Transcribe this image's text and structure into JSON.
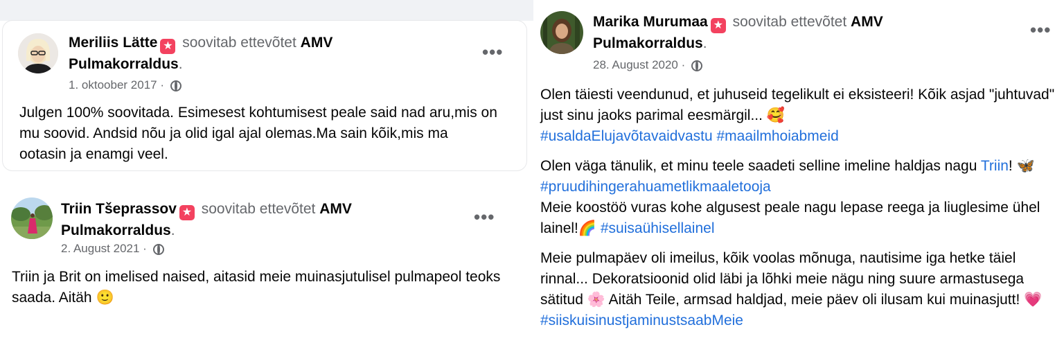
{
  "posts": [
    {
      "author": "Meriliis Lätte",
      "action": "soovitab ettevõtet",
      "page_line1": "AMV",
      "page_line2": "Pulmakorraldus",
      "date": "1. oktoober 2017",
      "text": "Julgen 100% soovitada. Esimesest kohtumisest peale said nad aru,mis on mu soovid. Andsid nõu ja olid igal ajal olemas.Ma sain kõik,mis ma ootasin ja enamgi veel."
    },
    {
      "author": "Triin Tšeprassov",
      "action": "soovitab ettevõtet",
      "page_line1": "AMV",
      "page_line2": "Pulmakorraldus",
      "date": "2. August 2021",
      "text": "Triin ja Brit on imelised naised, aitasid meie muinasjutulisel pulmapeol teoks saada. Aitäh",
      "emoji": "🙂"
    },
    {
      "author": "Marika Murumaa",
      "action": "soovitab ettevõtet",
      "page_line1": "AMV",
      "page_line2": "Pulmakorraldus",
      "date": "28. August 2020",
      "p1_text": "Olen täiesti veendunud, et juhuseid tegelikult ei eksisteeri! Kõik asjad \"juhtuvad\" just sinu jaoks parimal eesmärgil...",
      "p1_emoji": "🥰",
      "p1_tags": "#usaldaElujavõtavaidvastu #maailmhoiabmeid",
      "p2_line1": "Olen väga tänulik, et minu teele saadeti selline imeline haldjas nagu",
      "p2_link": "Triin",
      "p2_excl": "!",
      "p2_emoji": "🦋",
      "p2_tag": "#pruudihingerahuametlikmaaletooja",
      "p2_line3": "Meie koostöö vuras kohe algusest peale nagu lepase reega ja liuglesime ühel lainel!",
      "p2_emoji2": "🌈",
      "p2_tag2": "#suisaühisellainel",
      "p3_text": "Meie pulmapäev oli imeilus, kõik voolas mõnuga, nautisime iga hetke täiel rinnal... Dekoratsioonid olid läbi ja lõhki meie nägu ning suure armastusega sätitud",
      "p3_emoji": "🌸",
      "p3_text2": "Aitäh Teile, armsad haldjad, meie päev oli ilusam kui muinasjutt!",
      "p3_emoji2": "💗",
      "p3_tag": "#siiskuisinustjaminustsaabMeie"
    }
  ],
  "more_label": "•••",
  "star_glyph": "★",
  "separator": " · ",
  "period": "."
}
